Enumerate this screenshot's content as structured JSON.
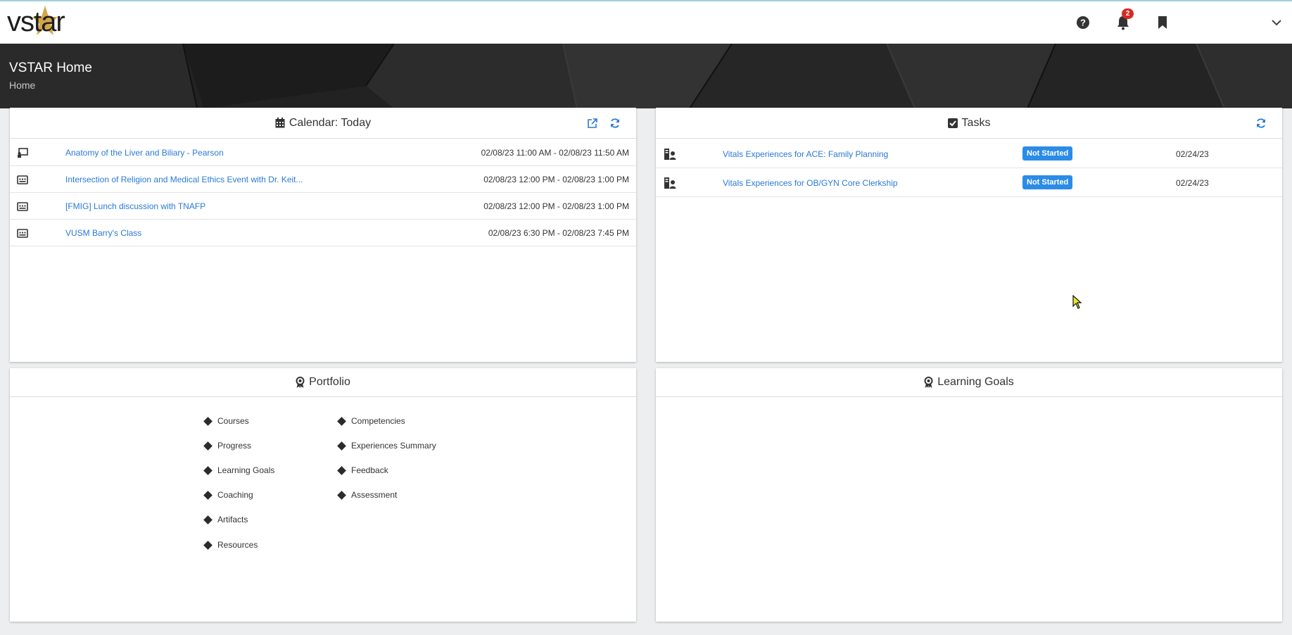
{
  "app": {
    "logo": "vstar"
  },
  "nav": {
    "notification_count": "2"
  },
  "header": {
    "title": "VSTAR Home",
    "breadcrumb": "Home"
  },
  "calendar": {
    "title": "Calendar: Today",
    "events": [
      {
        "icon": "presentation-icon",
        "title": "Anatomy of the Liver and Biliary - Pearson",
        "time": "02/08/23 11:00 AM - 02/08/23 11:50 AM"
      },
      {
        "icon": "event-icon",
        "title": "Intersection of Religion and Medical Ethics Event with Dr. Keit...",
        "time": "02/08/23 12:00 PM - 02/08/23 1:00 PM"
      },
      {
        "icon": "event-icon",
        "title": "[FMIG] Lunch discussion with TNAFP",
        "time": "02/08/23 12:00 PM - 02/08/23 1:00 PM"
      },
      {
        "icon": "event-icon",
        "title": "VUSM Barry's Class",
        "time": "02/08/23 6:30 PM - 02/08/23 7:45 PM"
      }
    ]
  },
  "tasks": {
    "title": "Tasks",
    "items": [
      {
        "title": "Vitals Experiences for ACE: Family Planning",
        "status": "Not Started",
        "date": "02/24/23"
      },
      {
        "title": "Vitals Experiences for OB/GYN Core Clerkship",
        "status": "Not Started",
        "date": "02/24/23"
      }
    ]
  },
  "portfolio": {
    "title": "Portfolio",
    "left": [
      "Courses",
      "Progress",
      "Learning Goals",
      "Coaching",
      "Artifacts",
      "Resources"
    ],
    "right": [
      "Competencies",
      "Experiences Summary",
      "Feedback",
      "Assessment"
    ]
  },
  "learning_goals": {
    "title": "Learning Goals"
  },
  "colors": {
    "link": "#2a7ad6",
    "badge": "#2b8ce6",
    "notification": "#d62b24",
    "logo_star": "#d4a545"
  }
}
